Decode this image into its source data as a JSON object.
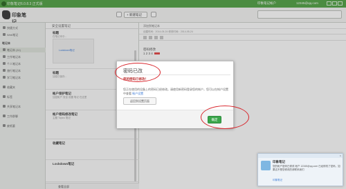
{
  "titlebar": {
    "title": "印象笔记6.0.8.3 正式版",
    "account": "印象笔记帐户",
    "user": "12345@qq.com"
  },
  "toolbar": {
    "brand": "印象笔记",
    "new_note": "+ 新建笔记"
  },
  "notelist": {
    "header": "安全设置笔记",
    "footer": "查看全部",
    "items": [
      {
        "title": "标题",
        "snippet": "在笔记本中..."
      },
      {
        "title": "Lockdown笔记",
        "snippet": ""
      },
      {
        "title": "标题",
        "snippet": "加密已保存..."
      },
      {
        "title": "帐户保护笔记",
        "snippet": "加密帐户 安全 设置 笔记 在这里"
      },
      {
        "title": "帐户密码修改笔记",
        "snippet": "主题 Topics 笔记"
      },
      {
        "title": "收藏笔记",
        "snippet": ""
      },
      {
        "title": "Lockdown笔记",
        "snippet": ""
      }
    ],
    "thumb_text": "Lockdown笔记"
  },
  "sidebar": {
    "items": [
      "快捷方式",
      "Web笔记",
      "笔记本",
      "笔记本 (11)",
      "工作笔记本",
      "个人笔记本",
      "旅行笔记本",
      "学习笔记本",
      "收藏夹",
      "标签",
      "共享笔记本",
      "工作群聊",
      "废纸篓"
    ]
  },
  "editor": {
    "row1": "添加到笔记本",
    "created": "创建时间：2014-05-24  修改时间：2014-05-24",
    "body_line1": "密码修改",
    "body_line2": "1 2 3 4"
  },
  "modal": {
    "title": "密码已改",
    "subtitle": "您的密码已修改！",
    "description": "您正在使用的设备上的密码已经修改。请使用新密码登录您的帐户，您可以在帐户设置中查看",
    "link": "帐户设置",
    "recover_button": "返回到设置页面",
    "ok_button": "确定"
  },
  "toast": {
    "title": "印象笔记",
    "body": "您的帐户密码已修改 帐户 12345@qq.com 已经修改了密码，如果这不是您修改的请联系我们",
    "sign": "印象笔记"
  },
  "colors": {
    "accent_green": "#53a347",
    "ok_green": "#3aa64b",
    "annotation_red": "#d8232a"
  }
}
